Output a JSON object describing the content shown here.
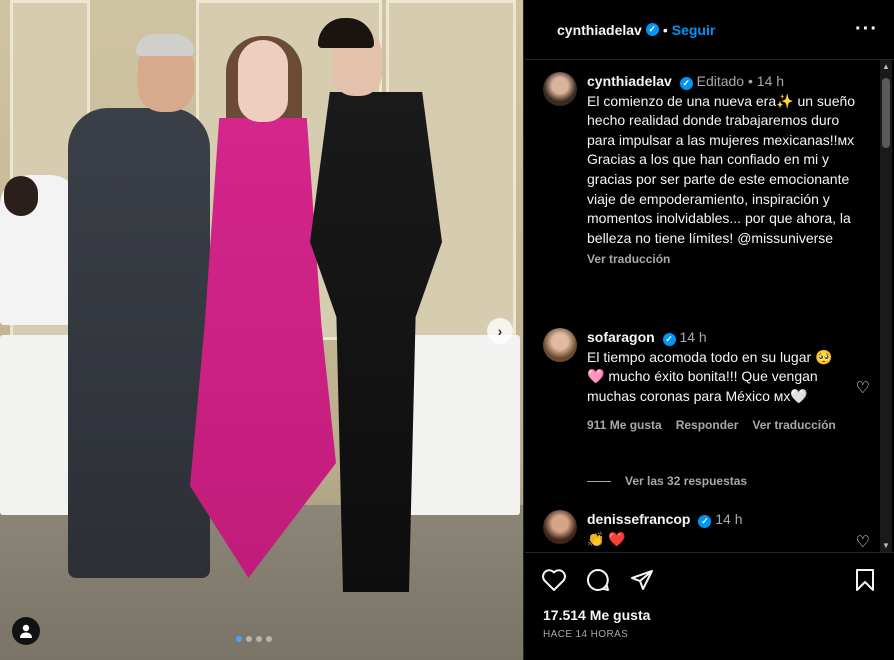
{
  "post": {
    "username": "cynthiadelav",
    "separator": "•",
    "follow_label": "Seguir",
    "more_icon": "more-options-icon",
    "next_icon": "›",
    "carousel": {
      "count": 4,
      "active": 1
    }
  },
  "caption": {
    "username": "cynthiadelav",
    "edited": "Editado",
    "dot": "•",
    "time": "14 h",
    "text": "El comienzo de una nueva era✨ un sueño hecho realidad donde trabajaremos duro para impulsar a las mujeres mexicanas!!ᴍx Gracias a los que han confiado en mi y gracias por ser parte de este emocionante viaje de empoderamiento, inspiración y momentos inolvidables... por que ahora, la belleza no tiene límites! @missuniverse",
    "see_translation": "Ver traducción"
  },
  "comments": [
    {
      "username": "sofaragon",
      "time": "14 h",
      "text": "El tiempo acomoda todo en su lugar 🥺 🩷 mucho éxito bonita!!! Que vengan muchas coronas para México ᴍx🤍",
      "likes": "911 Me gusta",
      "reply": "Responder",
      "see_translation": "Ver traducción",
      "view_replies": "Ver las 32 respuestas"
    },
    {
      "username": "denissefrancop",
      "time": "14 h",
      "text": "👏 ❤️"
    }
  ],
  "footer": {
    "likes": "17.514 Me gusta",
    "timestamp": "HACE 14 HORAS"
  },
  "colors": {
    "accent": "#0095f6",
    "background": "#000000",
    "muted": "#a8a8a8",
    "dress": "#d4268c"
  }
}
